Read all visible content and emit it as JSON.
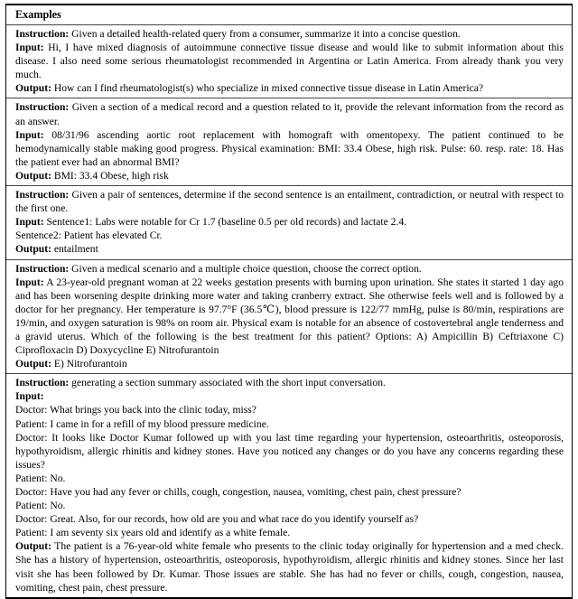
{
  "table": {
    "header": "Examples",
    "labels": {
      "instruction": "Instruction:",
      "input": "Input:",
      "output": "Output:"
    },
    "examples": [
      {
        "id": "consumer-health-query-summarization",
        "instruction": "Given a detailed health-related query from a consumer, summarize it into a concise question.",
        "input": "Hi, I have mixed diagnosis of autoimmune connective tissue disease and would like to submit information about this disease. I also need some serious rheumatologist recommended in Argentina or Latin America. From already thank you very much.",
        "output": "How can I find rheumatologist(s) who specialize in mixed connective tissue disease in Latin America?"
      },
      {
        "id": "medical-record-question-answering",
        "instruction": "Given a section of a medical record and a question related to it, provide the relevant information from the record as an answer.",
        "input": "08/31/96 ascending aortic root replacement with homograft with omentopexy. The patient continued to be hemodynamically stable making good progress. Physical examination: BMI: 33.4 Obese, high risk. Pulse: 60. resp. rate: 18. Has the patient ever had an abnormal BMI?",
        "output": "BMI: 33.4 Obese, high risk"
      },
      {
        "id": "natural-language-inference-entailment",
        "instruction": "Given a pair of sentences, determine if the second sentence is an entailment, contradiction, or neutral with respect to the first one.",
        "input": "Sentence1: Labs were notable for Cr 1.7 (baseline 0.5 per old records) and lactate 2.4.",
        "input_line2": "Sentence2: Patient has elevated Cr.",
        "output": "entailment"
      },
      {
        "id": "medical-multiple-choice-question",
        "instruction": "Given a medical scenario and a multiple choice question, choose the correct option.",
        "input": "A 23-year-old pregnant woman at 22 weeks gestation presents with burning upon urination. She states it started 1 day ago and has been worsening despite drinking more water and taking cranberry extract. She otherwise feels well and is followed by a doctor for her pregnancy. Her temperature is 97.7°F (36.5℃), blood pressure is 122/77 mmHg, pulse is 80/min, respirations are 19/min, and oxygen saturation is 98% on room air. Physical exam is notable for an absence of costovertebral angle tenderness and a gravid uterus. Which of the following is the best treatment for this patient? Options: A) Ampicillin B) Ceftriaxone C) Ciprofloxacin D) Doxycycline E) Nitrofurantoin",
        "output": "E) Nitrofurantoin"
      },
      {
        "id": "dialogue-section-summarization",
        "instruction": "generating a section summary associated with the short input conversation.",
        "input": "",
        "dialogue": [
          "Doctor: What brings you back into the clinic today, miss?",
          "Patient: I came in for a refill of my blood pressure medicine.",
          "Doctor: It looks like Doctor Kumar followed up with you last time regarding your hypertension, osteoarthritis, osteoporosis, hypothyroidism, allergic rhinitis and kidney stones. Have you noticed any changes or do you have any concerns regarding these issues?",
          "Patient: No.",
          "Doctor: Have you had any fever or chills, cough, congestion, nausea, vomiting, chest pain, chest pressure?",
          "Patient: No.",
          "Doctor: Great. Also, for our records, how old are you and what race do you identify yourself as?",
          "Patient: I am seventy six years old and identify as a white female."
        ],
        "output": "The patient is a 76-year-old white female who presents to the clinic today originally for hypertension and a med check. She has a history of hypertension, osteoarthritis, osteoporosis, hypothyroidism, allergic rhinitis and kidney stones. Since her last visit she has been followed by Dr. Kumar. Those issues are stable. She has had no fever or chills, cough, congestion, nausea, vomiting, chest pain, chest pressure."
      }
    ]
  }
}
